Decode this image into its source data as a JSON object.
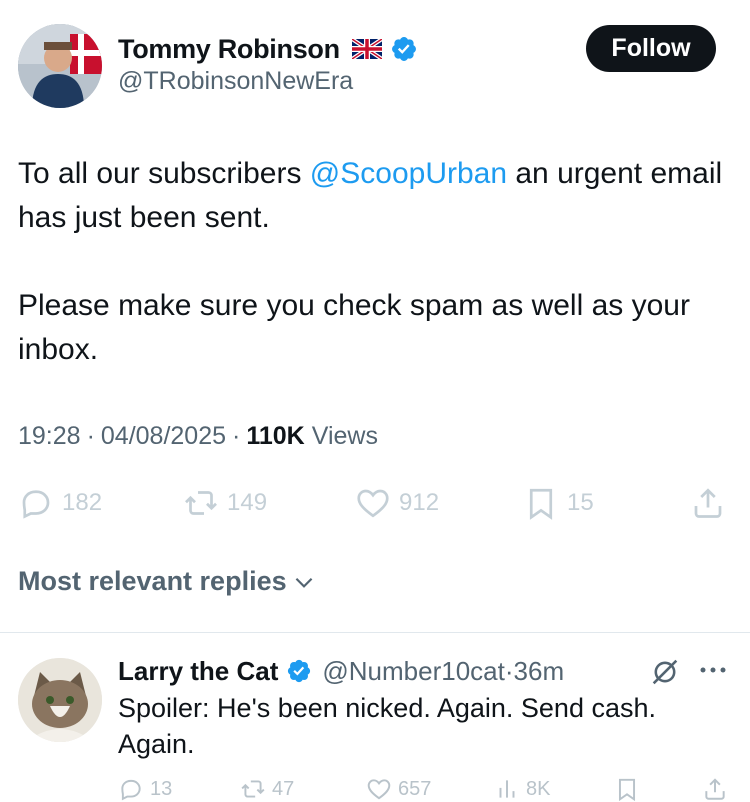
{
  "author": {
    "display_name": "Tommy Robinson",
    "handle": "@TRobinsonNewEra",
    "flag_icon": "uk-flag-icon",
    "verified_icon": "verified-badge-icon"
  },
  "follow_button": {
    "label": "Follow"
  },
  "tweet": {
    "line1_before": "To all our subscribers ",
    "mention": "@ScoopUrban",
    "line1_after": " an urgent email has just been sent.",
    "paragraph2": "Please make sure you check spam as well as your inbox."
  },
  "meta": {
    "time": "19:28",
    "date": "04/08/2025",
    "views_count": "110K",
    "views_label": "Views",
    "separator": "·"
  },
  "actions": {
    "replies": "182",
    "reposts": "149",
    "likes": "912",
    "bookmarks": "15"
  },
  "replies_header": {
    "label": "Most relevant replies"
  },
  "reply": {
    "display_name": "Larry the Cat",
    "handle": "@Number10cat",
    "separator": "·",
    "time": "36m",
    "text": "Spoiler: He's been nicked. Again. Send cash. Again.",
    "actions": {
      "replies": "13",
      "reposts": "47",
      "likes": "657",
      "views": "8K"
    }
  },
  "colors": {
    "accent": "#1d9bf0",
    "text_primary": "#0f1419",
    "text_secondary": "#536471",
    "follow_bg": "#0f1419"
  }
}
